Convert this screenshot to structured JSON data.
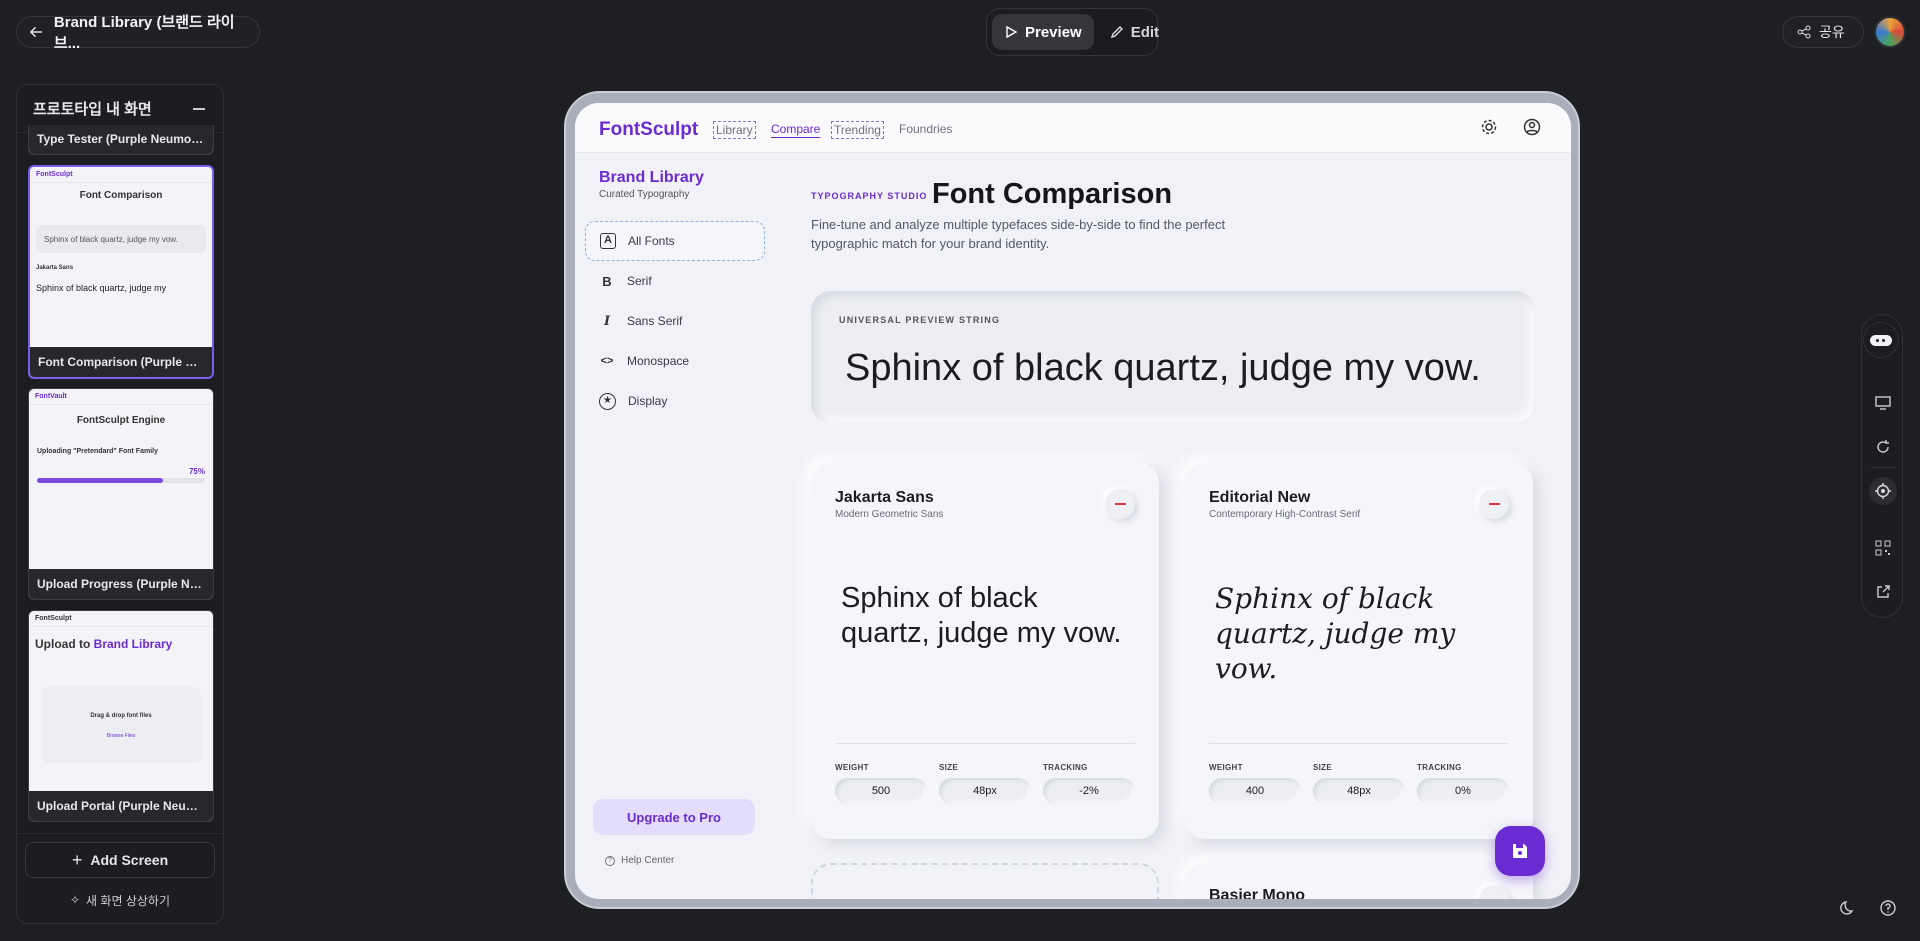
{
  "topbar": {
    "back_title": "Brand Library (브랜드 라이브...",
    "preview_label": "Preview",
    "edit_label": "Edit",
    "share_label": "공유"
  },
  "panel": {
    "title": "프로토타입 내 화면",
    "screens": [
      {
        "caption": "Type Tester (Purple Neumorp..."
      },
      {
        "caption": "Font Comparison (Purple Neu...",
        "selected": true,
        "mini": {
          "logo": "FontSculpt",
          "title": "Font Comparison",
          "preview": "Sphinx of black quartz, judge my vow.",
          "card_name": "Jakarta Sans",
          "card_text": "Sphinx of black quartz, judge my"
        }
      },
      {
        "caption": "Upload Progress (Purple Neu...",
        "mini": {
          "logo": "FontVault",
          "title": "FontSculpt Engine",
          "upload": "Uploading \"Pretendard\" Font Family",
          "percent": "75%",
          "progress": 0.75
        }
      },
      {
        "caption": "Upload Portal (Purple Neumor...",
        "mini": {
          "logo": "FontSculpt",
          "title_a": "Upload to ",
          "title_b": "Brand Library",
          "drop": "Drag & drop font files",
          "browse": "Browse Files"
        }
      }
    ],
    "add_screen": "Add Screen",
    "imagine": "새 화면 상상하기"
  },
  "app": {
    "logo": "FontSculpt",
    "nav": [
      "Library",
      "Compare",
      "Trending",
      "Foundries"
    ],
    "brand": "Brand Library",
    "brand_sub": "Curated Typography",
    "sidebar": [
      {
        "label": "All Fonts",
        "glyph": "A"
      },
      {
        "label": "Serif",
        "glyph": "B"
      },
      {
        "label": "Sans Serif",
        "glyph": "I"
      },
      {
        "label": "Monospace",
        "glyph": "<>"
      },
      {
        "label": "Display",
        "glyph": "★"
      }
    ],
    "upgrade": "Upgrade to Pro",
    "help": "Help Center",
    "eyebrow": "TYPOGRAPHY STUDIO",
    "title": "Font Comparison",
    "description": "Fine-tune and analyze multiple typefaces side-by-side to find the perfect typographic match for your brand identity.",
    "preview_label": "UNIVERSAL PREVIEW STRING",
    "preview_text": "Sphinx of black quartz, judge my vow.",
    "control_labels": {
      "weight": "WEIGHT",
      "size": "SIZE",
      "tracking": "TRACKING"
    },
    "cards": [
      {
        "name": "Jakarta Sans",
        "classification": "Modern Geometric Sans",
        "sample": "Sphinx of black quartz, judge my vow.",
        "weight": "500",
        "size": "48px",
        "tracking": "-2%"
      },
      {
        "name": "Editorial New",
        "classification": "Contemporary High-Contrast Serif",
        "sample": "Sphinx of black quartz, judge my vow.",
        "weight": "400",
        "size": "48px",
        "tracking": "0%"
      },
      {
        "name": "Basier Mono"
      }
    ]
  },
  "colors": {
    "accent": "#6b2bd3",
    "danger": "#d9363e",
    "bg": "#1d1f23"
  }
}
